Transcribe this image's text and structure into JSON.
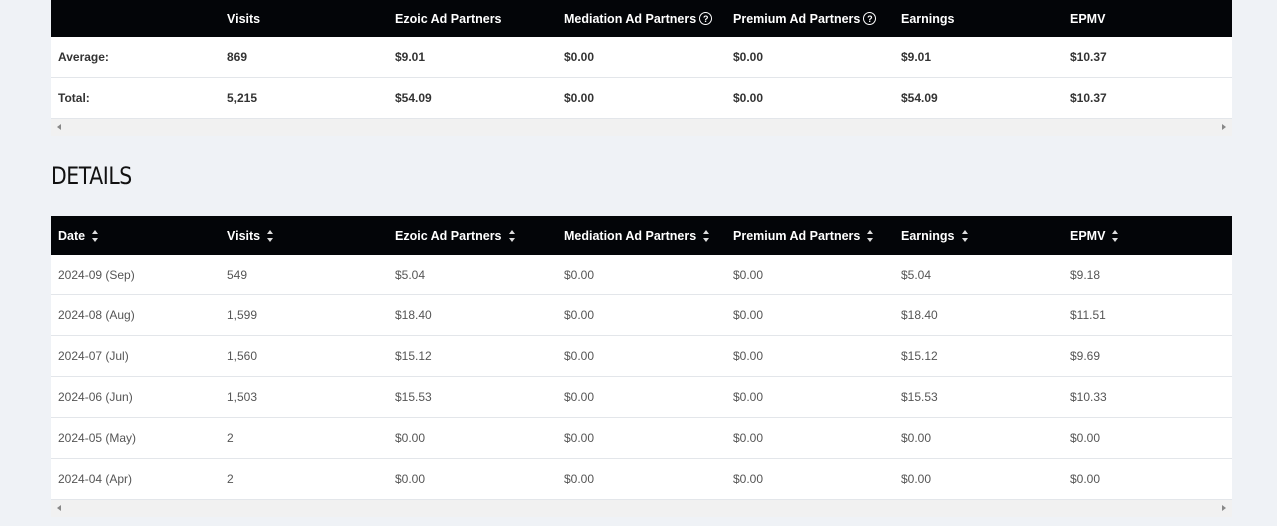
{
  "summary": {
    "columns": [
      "",
      "Visits",
      "Ezoic Ad Partners",
      "Mediation Ad Partners",
      "Premium Ad Partners",
      "Earnings",
      "EPMV"
    ],
    "rows": [
      [
        "Average:",
        "869",
        "$9.01",
        "$0.00",
        "$0.00",
        "$9.01",
        "$10.37"
      ],
      [
        "Total:",
        "5,215",
        "$54.09",
        "$0.00",
        "$0.00",
        "$54.09",
        "$10.37"
      ]
    ]
  },
  "details": {
    "title": "DETAILS",
    "columns": [
      "Date",
      "Visits",
      "Ezoic Ad Partners",
      "Mediation Ad Partners",
      "Premium Ad Partners",
      "Earnings",
      "EPMV"
    ],
    "rows": [
      [
        "2024-09 (Sep)",
        "549",
        "$5.04",
        "$0.00",
        "$0.00",
        "$5.04",
        "$9.18"
      ],
      [
        "2024-08 (Aug)",
        "1,599",
        "$18.40",
        "$0.00",
        "$0.00",
        "$18.40",
        "$11.51"
      ],
      [
        "2024-07 (Jul)",
        "1,560",
        "$15.12",
        "$0.00",
        "$0.00",
        "$15.12",
        "$9.69"
      ],
      [
        "2024-06 (Jun)",
        "1,503",
        "$15.53",
        "$0.00",
        "$0.00",
        "$15.53",
        "$10.33"
      ],
      [
        "2024-05 (May)",
        "2",
        "$0.00",
        "$0.00",
        "$0.00",
        "$0.00",
        "$0.00"
      ],
      [
        "2024-04 (Apr)",
        "2",
        "$0.00",
        "$0.00",
        "$0.00",
        "$0.00",
        "$0.00"
      ]
    ]
  },
  "icons": {
    "help": "?"
  }
}
